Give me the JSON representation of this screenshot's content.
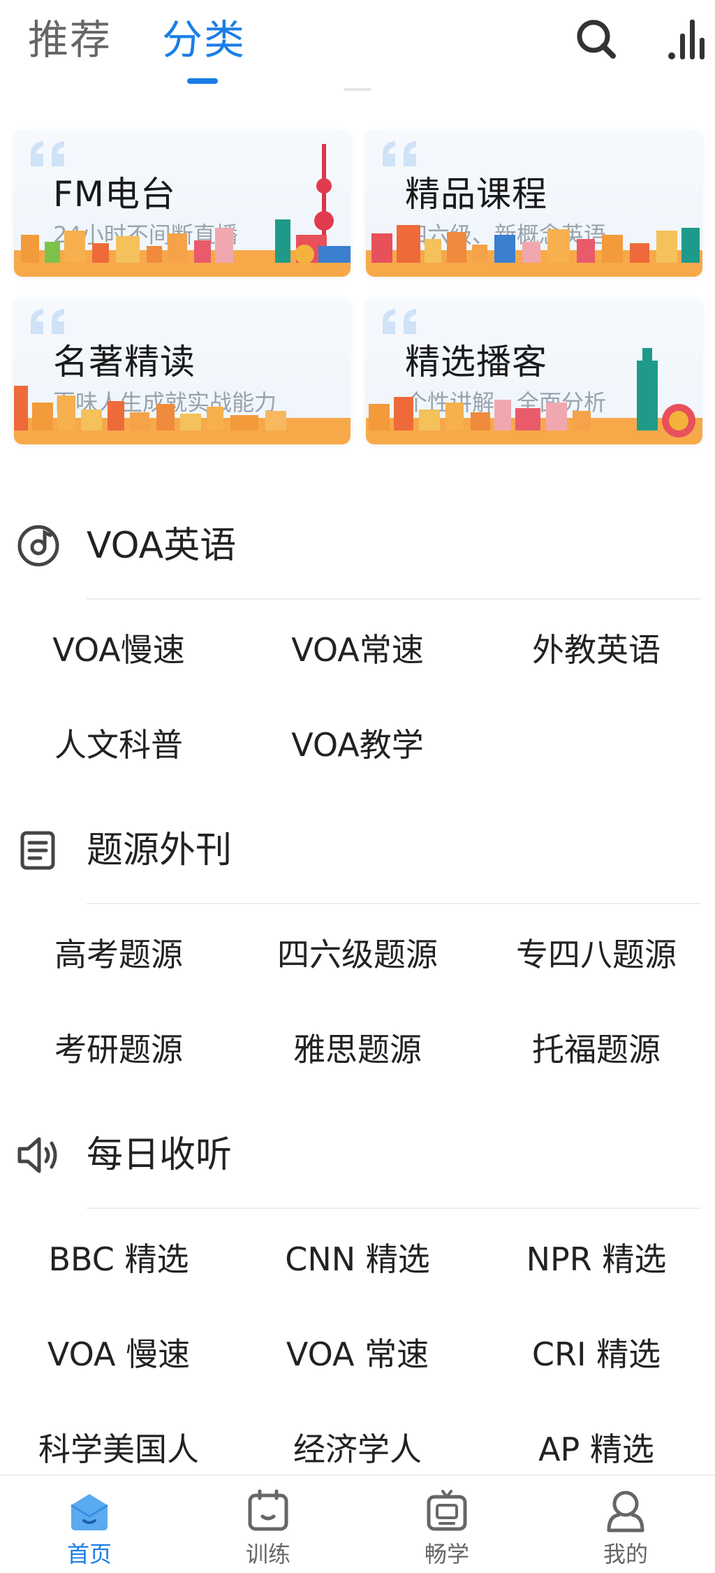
{
  "colors": {
    "accent": "#1a7ee6",
    "text": "#222222",
    "muted": "#666666",
    "subtitle": "#9aa3ad"
  },
  "header": {
    "tabs": [
      {
        "label": "推荐",
        "active": false
      },
      {
        "label": "分类",
        "active": true
      }
    ],
    "icons": [
      "search-icon",
      "chart-icon"
    ]
  },
  "cards": [
    {
      "title": "FM电台",
      "subtitle": "24小时不间断直播"
    },
    {
      "title": "精品课程",
      "subtitle": "四六级、新概念英语"
    },
    {
      "title": "名著精读",
      "subtitle": "百味人生成就实战能力"
    },
    {
      "title": "精选播客",
      "subtitle": "个性讲解、全面分析"
    }
  ],
  "sections": [
    {
      "title": "VOA英语",
      "icon": "disc-icon",
      "items": [
        "VOA慢速",
        "VOA常速",
        "外教英语",
        "人文科普",
        "VOA教学"
      ]
    },
    {
      "title": "题源外刊",
      "icon": "document-icon",
      "items": [
        "高考题源",
        "四六级题源",
        "专四八题源",
        "考研题源",
        "雅思题源",
        "托福题源"
      ]
    },
    {
      "title": "每日收听",
      "icon": "speaker-icon",
      "items": [
        "BBC 精选",
        "CNN 精选",
        "NPR 精选",
        "VOA 慢速",
        "VOA 常速",
        "CRI 精选",
        "科学美国人",
        "经济学人",
        "AP 精选"
      ]
    }
  ],
  "bottom_nav": [
    {
      "label": "首页",
      "icon": "home-icon",
      "active": true
    },
    {
      "label": "训练",
      "icon": "calendar-icon",
      "active": false
    },
    {
      "label": "畅学",
      "icon": "radio-icon",
      "active": false
    },
    {
      "label": "我的",
      "icon": "profile-icon",
      "active": false
    }
  ]
}
